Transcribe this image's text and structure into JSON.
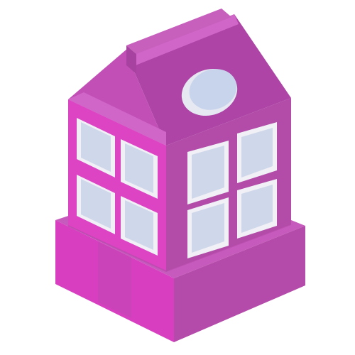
{
  "scene": {
    "subject": "isometric-pink-house-icon",
    "colors": {
      "background": "#ffffff",
      "left_wall": "#dd44c4",
      "right_wall": "#b34ca8",
      "roof_left": "#c24fb6",
      "roof_right": "#ad44a6",
      "roof_top": "#d166c9",
      "chimney_front": "#a742a0",
      "chimney_top": "#c75fbd",
      "base_left": "#d83fc0",
      "base_right": "#b44aa9",
      "base_top": "#c75bbd",
      "window_glass": "#cfd7ea",
      "window_frame": "#f0f0f6",
      "round_window": "#c8d3ec",
      "round_window_rim": "#e6e8f2"
    }
  }
}
